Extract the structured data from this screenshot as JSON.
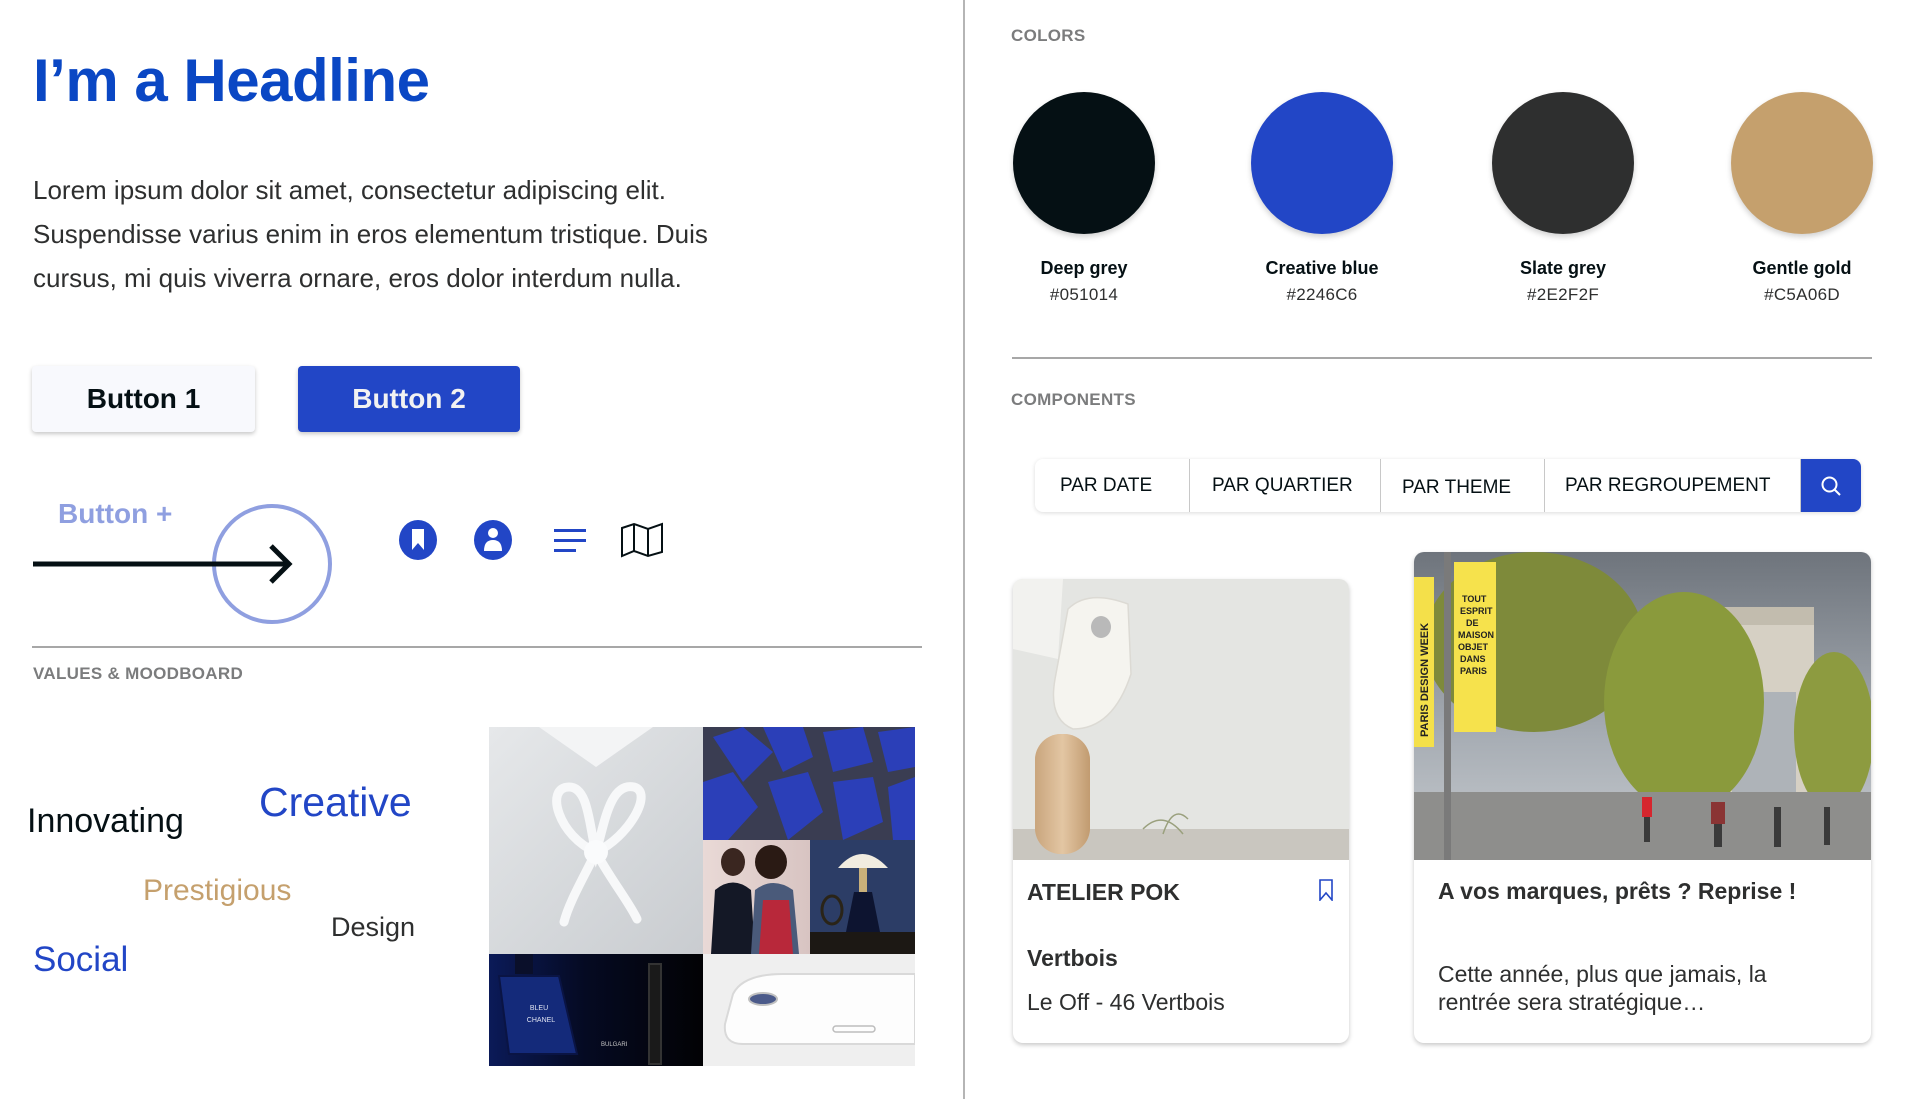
{
  "left": {
    "headline": "I’m a Headline",
    "intro": "Lorem ipsum dolor sit amet, consectetur adipiscing elit. Suspendisse varius enim in eros elementum tristique. Duis cursus, mi quis viverra ornare, eros dolor interdum nulla.",
    "buttons": {
      "button1": "Button 1",
      "button2": "Button 2",
      "button_plus": "Button  +"
    },
    "icons": [
      "bookmark-icon",
      "user-icon",
      "menu-icon",
      "map-icon"
    ],
    "values_section_label": "VALUES & MOODBOARD",
    "values": {
      "innovating": "Innovating",
      "creative": "Creative",
      "prestigious": "Prestigious",
      "design": "Design",
      "social": "Social"
    },
    "moodboard": {
      "perfume_text": "BLEU DE CHANEL",
      "watch_text": "BULGARI"
    }
  },
  "right": {
    "colors_section_label": "COLORS",
    "colors": [
      {
        "name": "Deep grey",
        "hex": "#051014"
      },
      {
        "name": "Creative blue",
        "hex": "#2246C6"
      },
      {
        "name": "Slate grey",
        "hex": "#2E2F2F"
      },
      {
        "name": "Gentle gold",
        "hex": "#C5A06D"
      }
    ],
    "components_section_label": "COMPONENTS",
    "filters": [
      "PAR DATE",
      "PAR QUARTIER",
      "PAR THEME",
      "PAR REGROUPEMENT"
    ],
    "search_icon": "search-icon",
    "cards": [
      {
        "title": "ATELIER POK",
        "subtitle": "Vertbois",
        "address": "Le Off - 46 Vertbois",
        "icon": "bookmark-outline-icon"
      },
      {
        "title": "A vos marques, prêts ? Reprise !",
        "body": "Cette année, plus que jamais, la rentrée sera stratégique…",
        "banner_text_1": "PARIS DESIGN WEEK",
        "banner_text_2": "TOUT ESPRIT DE MAISON OBJET DANS PARIS"
      }
    ]
  },
  "theme": {
    "headline_color": "#0a47c4",
    "accent": "#2246c6",
    "gold": "#c5a06d",
    "deep_grey": "#051014",
    "slate_grey": "#2e2f2f",
    "button_plus_color": "#8f9fe0"
  }
}
